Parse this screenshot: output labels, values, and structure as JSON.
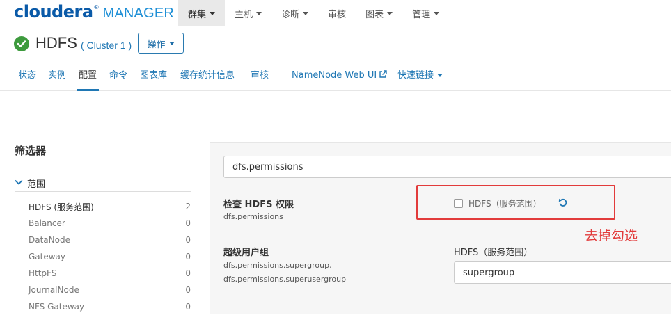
{
  "brand": {
    "main": "cloudera",
    "reg": "®",
    "sub": "MANAGER"
  },
  "topnav": {
    "items": [
      {
        "label": "群集"
      },
      {
        "label": "主机"
      },
      {
        "label": "诊断"
      },
      {
        "label": "审核"
      },
      {
        "label": "图表"
      },
      {
        "label": "管理"
      }
    ]
  },
  "service": {
    "name": "HDFS",
    "cluster": "( Cluster 1 )",
    "action_label": "操作",
    "status_color": "#3d9a3d"
  },
  "subtabs": {
    "items": [
      {
        "label": "状态"
      },
      {
        "label": "实例"
      },
      {
        "label": "配置"
      },
      {
        "label": "命令"
      },
      {
        "label": "图表库"
      },
      {
        "label": "缓存统计信息"
      },
      {
        "label": "审核"
      },
      {
        "label": "NameNode Web UI"
      },
      {
        "label": "快速链接"
      }
    ],
    "active": "配置"
  },
  "filters": {
    "title": "筛选器",
    "scope_heading": "范围",
    "items": [
      {
        "label": "HDFS (服务范围)",
        "count": "2"
      },
      {
        "label": "Balancer",
        "count": "0"
      },
      {
        "label": "DataNode",
        "count": "0"
      },
      {
        "label": "Gateway",
        "count": "0"
      },
      {
        "label": "HttpFS",
        "count": "0"
      },
      {
        "label": "JournalNode",
        "count": "0"
      },
      {
        "label": "NFS Gateway",
        "count": "0"
      }
    ]
  },
  "search": {
    "value": "dfs.permissions"
  },
  "properties": {
    "permissions": {
      "label": "检查 HDFS 权限",
      "key": "dfs.permissions",
      "checkbox_label": "HDFS（服务范围）",
      "checked": false
    },
    "supergroup": {
      "label": "超级用户组",
      "key1": "dfs.permissions.supergroup,",
      "key2": "dfs.permissions.superusergroup",
      "scope_label": "HDFS（服务范围）",
      "value": "supergroup"
    }
  },
  "annotation": {
    "text": "去掉勾选",
    "color": "#e23b3b"
  },
  "colors": {
    "accent": "#1f77b4",
    "brand": "#0a5aa8",
    "annotation": "#e23b3b"
  }
}
